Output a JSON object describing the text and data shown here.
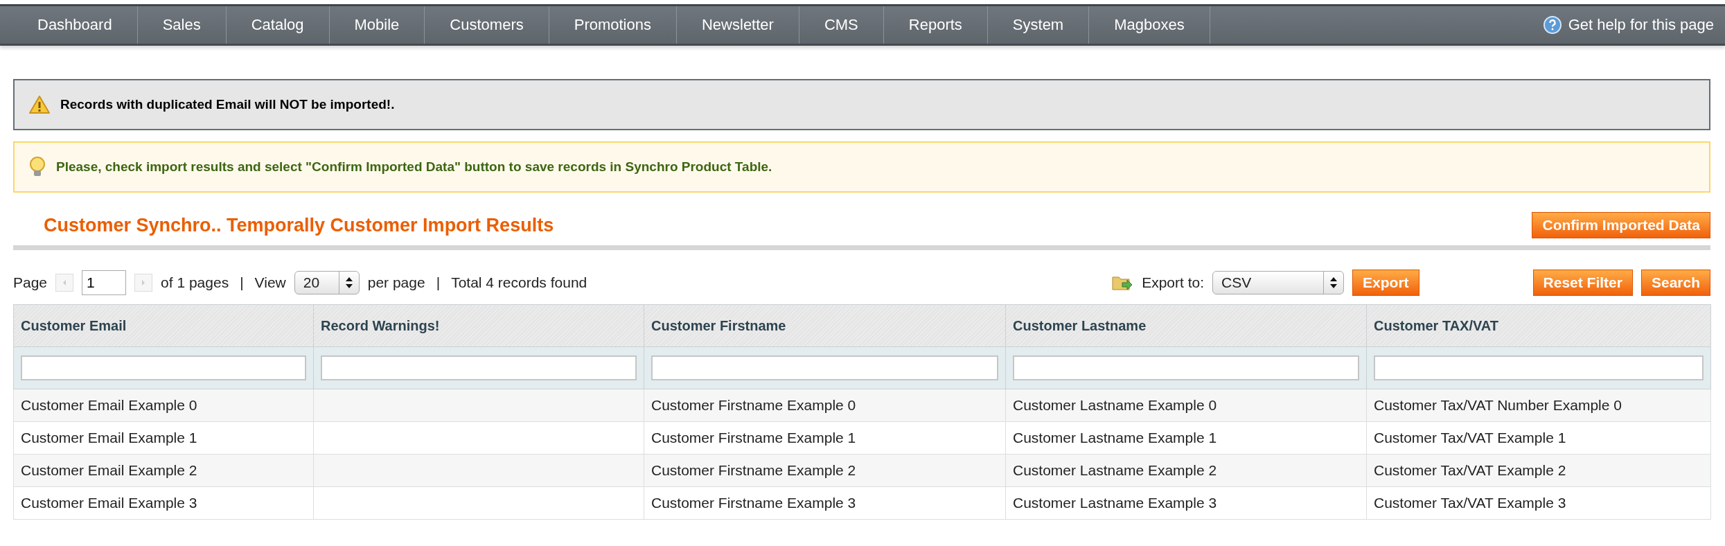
{
  "nav": {
    "items": [
      {
        "label": "Dashboard"
      },
      {
        "label": "Sales"
      },
      {
        "label": "Catalog"
      },
      {
        "label": "Mobile"
      },
      {
        "label": "Customers"
      },
      {
        "label": "Promotions"
      },
      {
        "label": "Newsletter"
      },
      {
        "label": "CMS"
      },
      {
        "label": "Reports"
      },
      {
        "label": "System"
      },
      {
        "label": "Magboxes"
      }
    ],
    "help": "Get help for this page"
  },
  "messages": [
    {
      "kind": "warning",
      "text": "Records with duplicated Email will NOT be imported!."
    },
    {
      "kind": "notice",
      "text": "Please, check import results and select \"Confirm Imported Data\" button to save records in Synchro Product Table."
    }
  ],
  "page_title": "Customer Synchro.. Temporally Customer Import Results",
  "confirm_button": "Confirm Imported Data",
  "pager": {
    "page_label": "Page",
    "page": "1",
    "of_pages": "of 1 pages",
    "sep": "|",
    "view_label": "View",
    "per_page": "20",
    "per_page_label": "per page",
    "total": "Total 4 records found"
  },
  "export": {
    "label": "Export to:",
    "format": "CSV",
    "button": "Export"
  },
  "reset_button": "Reset Filter",
  "search_button": "Search",
  "table": {
    "columns": [
      "Customer Email",
      "Record Warnings!",
      "Customer Firstname",
      "Customer Lastname",
      "Customer TAX/VAT"
    ],
    "rows": [
      [
        "Customer Email Example 0",
        "",
        "Customer Firstname Example 0",
        "Customer Lastname Example 0",
        "Customer Tax/VAT Number Example 0"
      ],
      [
        "Customer Email Example 1",
        "",
        "Customer Firstname Example 1",
        "Customer Lastname Example 1",
        "Customer Tax/VAT Example 1"
      ],
      [
        "Customer Email Example 2",
        "",
        "Customer Firstname Example 2",
        "Customer Lastname Example 2",
        "Customer Tax/VAT Example 2"
      ],
      [
        "Customer Email Example 3",
        "",
        "Customer Firstname Example 3",
        "Customer Lastname Example 3",
        "Customer Tax/VAT Example 3"
      ]
    ]
  }
}
